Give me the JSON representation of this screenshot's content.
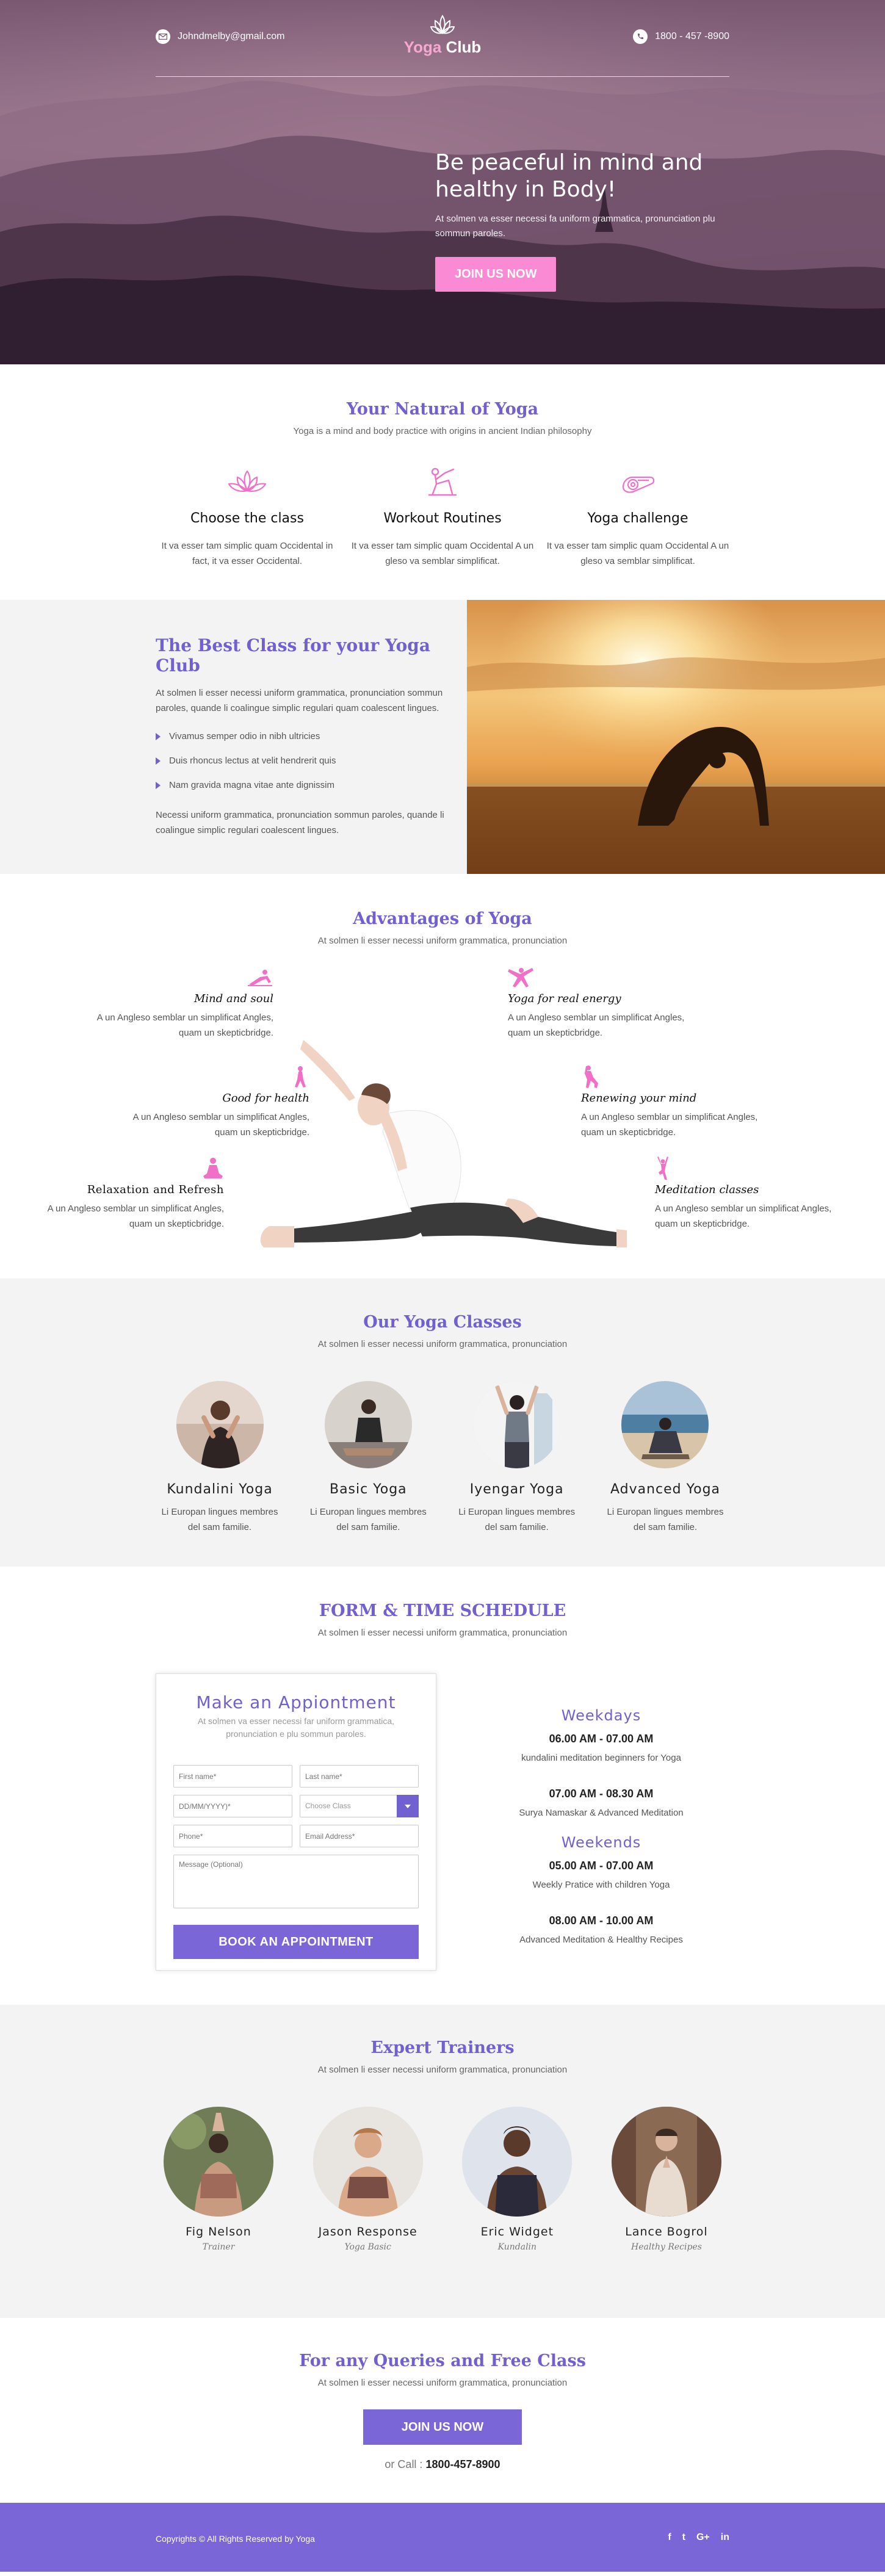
{
  "header": {
    "email": "Johndmelby@gmail.com",
    "phone": "1800 - 457 -8900",
    "logo_word1": "Yoga",
    "logo_word2": " Club"
  },
  "hero": {
    "title": "Be peaceful in mind and healthy in Body!",
    "text": "At solmen va esser necessi fa uniform grammatica, pronunciation plu sommun paroles.",
    "cta": "JOIN US NOW"
  },
  "natural": {
    "title": "Your Natural of Yoga",
    "subtitle": "Yoga is a mind and body practice with origins in ancient Indian philosophy",
    "features": [
      {
        "icon": "lotus-icon",
        "title": "Choose the class",
        "text": "It va esser tam simplic quam Occidental in fact, it va esser Occidental."
      },
      {
        "icon": "yoga-pose-icon",
        "title": "Workout Routines",
        "text": "It va esser tam simplic quam Occidental A un gleso va semblar simplificat."
      },
      {
        "icon": "yoga-mat-icon",
        "title": "Yoga challenge",
        "text": "It va esser tam simplic quam Occidental A un gleso va semblar simplificat."
      }
    ]
  },
  "best": {
    "title": "The Best Class for your Yoga Club",
    "intro": "At solmen li esser necessi uniform grammatica, pronunciation sommun paroles, quande li coalingue simplic regulari quam coalescent lingues.",
    "bullets": [
      "Vivamus semper odio in nibh ultricies",
      "Duis rhoncus lectus at velit hendrerit quis",
      "Nam gravida magna vitae ante dignissim"
    ],
    "outro": "Necessi uniform grammatica, pronunciation sommun paroles, quande li coalingue simplic regulari coalescent lingues."
  },
  "advantages": {
    "title": "Advantages of Yoga",
    "subtitle": "At solmen li esser necessi uniform grammatica, pronunciation",
    "items": [
      {
        "title": "Mind and soul",
        "text": "A un Angleso  semblar un simplificat Angles, quam un skepticbridge."
      },
      {
        "title": "Good for health",
        "text": "A un Angleso  semblar un simplificat Angles, quam un skepticbridge."
      },
      {
        "title": "Relaxation and Refresh",
        "text": "A un Angleso  semblar un simplificat Angles, quam un skepticbridge."
      },
      {
        "title": "Yoga for real energy",
        "text": "A un Angleso  semblar un simplificat Angles, quam un skepticbridge."
      },
      {
        "title": "Renewing your mind",
        "text": "A un Angleso  semblar un simplificat Angles, quam un skepticbridge."
      },
      {
        "title": "Meditation classes",
        "text": "A un Angleso  semblar un simplificat Angles, quam un skepticbridge."
      }
    ]
  },
  "classes": {
    "title": "Our Yoga Classes",
    "subtitle": "At solmen li esser necessi uniform grammatica, pronunciation",
    "items": [
      {
        "name": "Kundalini Yoga",
        "text": "Li Europan lingues membres del sam familie."
      },
      {
        "name": "Basic Yoga",
        "text": "Li Europan lingues membres del sam familie."
      },
      {
        "name": "Iyengar Yoga",
        "text": "Li Europan lingues membres del sam familie."
      },
      {
        "name": "Advanced Yoga",
        "text": "Li Europan lingues membres del sam familie."
      }
    ]
  },
  "schedule": {
    "title": "FORM & TIME SCHEDULE",
    "subtitle": "At solmen li esser necessi uniform grammatica, pronunciation",
    "form": {
      "title": "Make an Appiontment",
      "subtitle": "At solmen va esser necessi far uniform grammatica, pronunciation e plu sommun paroles.",
      "first_name": "First name*",
      "last_name": "Last name*",
      "date": "DD/MM/YYYY)*",
      "class": "Choose Class",
      "phone": "Phone*",
      "email": "Email Address*",
      "message": "Message (Optional)",
      "submit": "BOOK AN APPOINTMENT"
    },
    "weekdays": {
      "label": "Weekdays",
      "slots": [
        {
          "time": "06.00 AM - 07.00 AM",
          "desc": "kundalini meditation beginners for Yoga"
        },
        {
          "time": "07.00 AM - 08.30 AM",
          "desc": "Surya Namaskar & Advanced Meditation"
        }
      ]
    },
    "weekends": {
      "label": "Weekends",
      "slots": [
        {
          "time": "05.00 AM - 07.00 AM",
          "desc": "Weekly Pratice with children Yoga"
        },
        {
          "time": "08.00 AM - 10.00 AM",
          "desc": "Advanced Meditation & Healthy Recipes"
        }
      ]
    }
  },
  "trainers": {
    "title": "Expert Trainers",
    "subtitle": "At solmen li esser necessi uniform grammatica, pronunciation",
    "items": [
      {
        "name": "Fig Nelson",
        "role": "Trainer"
      },
      {
        "name": "Jason Response",
        "role": "Yoga Basic"
      },
      {
        "name": "Eric Widget",
        "role": "Kundalin"
      },
      {
        "name": "Lance Bogrol",
        "role": "Healthy Recipes"
      }
    ]
  },
  "queries": {
    "title": "For any Queries and Free Class",
    "subtitle": "At solmen li esser necessi uniform grammatica, pronunciation",
    "cta": "JOIN US NOW",
    "call_prefix": "or Call : ",
    "call_number": "1800-457-8900"
  },
  "footer": {
    "copyright": "Copyrights © All Rights Reserved by Yoga",
    "social": [
      "f",
      "t",
      "G+",
      "in"
    ]
  },
  "colors": {
    "accent": "#7a66d6",
    "title": "#7060d0",
    "pink": "#f98ad3",
    "section_bg": "#f3f3f3"
  }
}
